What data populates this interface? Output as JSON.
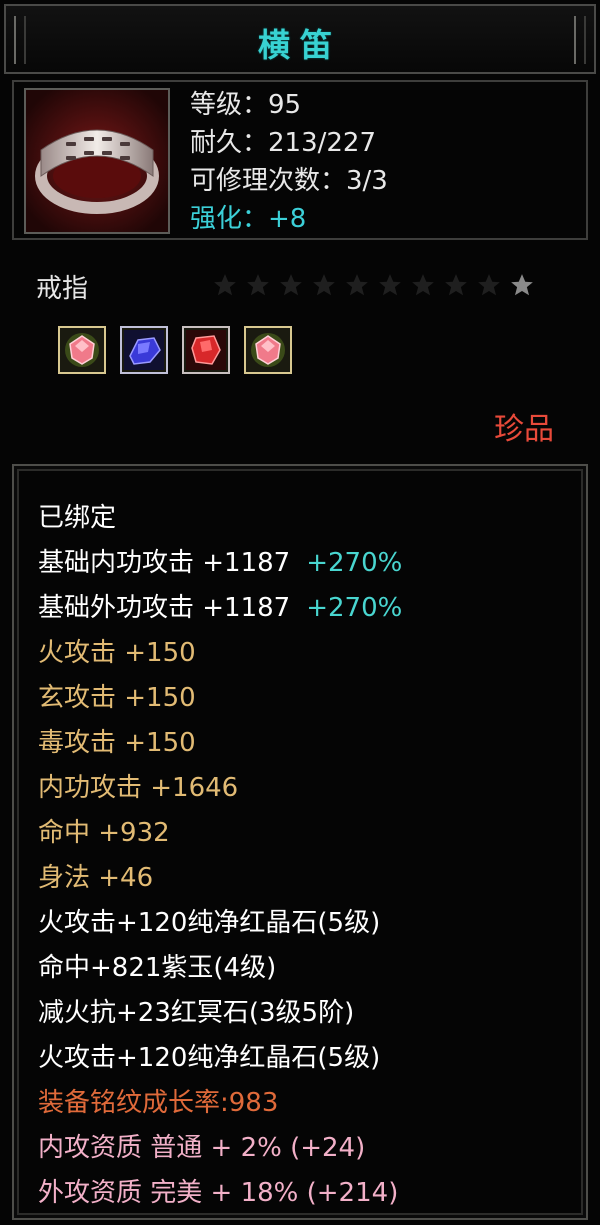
{
  "item": {
    "name": "横笛",
    "type": "戒指",
    "rarity": "珍品",
    "stats": [
      {
        "label": "等级：95",
        "color": "#e8e8e8"
      },
      {
        "label": "耐久：213/227",
        "color": "#e8e8e8"
      },
      {
        "label": "可修理次数：3/3",
        "color": "#e8e8e8"
      },
      {
        "label": "强化：+8",
        "color": "#3cd0d8"
      }
    ],
    "stars": {
      "total": 10,
      "lit": 1
    },
    "gems": [
      "pink-gem-icon",
      "blue-gem-icon",
      "red-gem-icon",
      "pink-gem-icon"
    ],
    "icon": "ring-icon"
  },
  "attributes": [
    {
      "text": "已绑定",
      "style": "white"
    },
    {
      "text": "基础内功攻击 +1187",
      "extra": "+270%",
      "style": "white"
    },
    {
      "text": "基础外功攻击 +1187",
      "extra": "+270%",
      "style": "white"
    },
    {
      "text": "火攻击 +150",
      "style": "gold"
    },
    {
      "text": "玄攻击 +150",
      "style": "gold"
    },
    {
      "text": "毒攻击 +150",
      "style": "gold"
    },
    {
      "text": "内功攻击 +1646",
      "style": "gold"
    },
    {
      "text": "命中 +932",
      "style": "gold"
    },
    {
      "text": "身法 +46",
      "style": "gold"
    },
    {
      "text": "火攻击+120纯净红晶石(5级)",
      "style": "white"
    },
    {
      "text": "命中+821紫玉(4级)",
      "style": "white"
    },
    {
      "text": "减火抗+23红冥石(3级5阶)",
      "style": "white"
    },
    {
      "text": "火攻击+120纯净红晶石(5级)",
      "style": "white"
    },
    {
      "text": "装备铭纹成长率:983",
      "style": "orange"
    },
    {
      "text": "内攻资质 普通 + 2% (+24)",
      "style": "pink"
    },
    {
      "text": "外攻资质 完美 + 18% (+214)",
      "style": "pink"
    }
  ],
  "colors": {
    "title": "#38d2d2",
    "enhance": "#3cd0d8",
    "percent": "#49d6d0",
    "attribute_gold": "#e2bb74",
    "growth_orange": "#e06a3a",
    "quality_pink": "#f2b0c8",
    "rarity_red": "#e84a3a"
  }
}
